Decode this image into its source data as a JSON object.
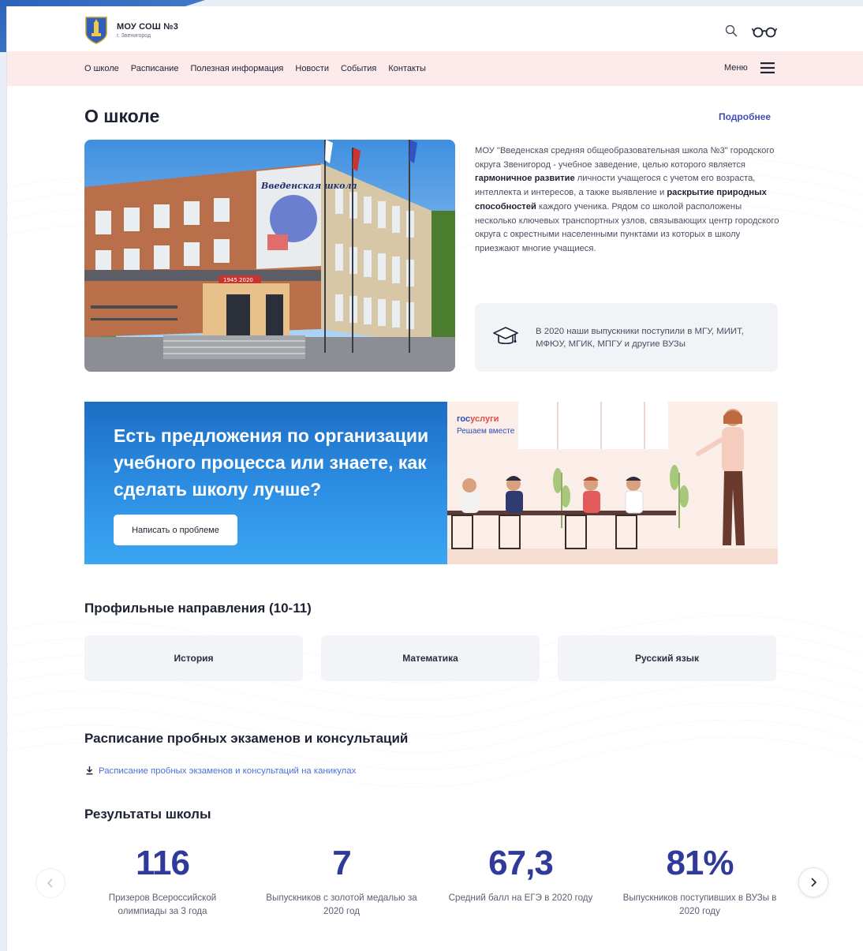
{
  "header": {
    "logo_title": "МОУ СОШ №3",
    "logo_subtitle": "г. Звенигород"
  },
  "nav": {
    "items": [
      "О школе",
      "Расписание",
      "Полезная информация",
      "Новости",
      "События",
      "Контакты"
    ],
    "menu_label": "Меню"
  },
  "about": {
    "title": "О школе",
    "more_link": "Подробнее",
    "text_1": "МОУ \"Введенская средняя общеобразовательная школа №3\" городского округа Звенигород - учебное заведение, целью которого является ",
    "text_bold_1": "гармоничное развитие",
    "text_2": " личности учащегося с учетом его возраста, интеллекта и интересов, а также выявление и ",
    "text_bold_2": "раскрытие природных способностей",
    "text_3": " каждого ученика. Рядом со школой расположены несколько ключевых транспортных узлов, связывающих центр городского округа с окрестными населенными пунктами из которых в школу приезжают многие учащиеся.",
    "photo_sign": "Введенская школа",
    "photo_banner": "1945 2020",
    "grads_text": "В 2020 наши выпускники поступили в МГУ, МИИТ, МФЮУ, МГИК, МПГУ и другие ВУЗы"
  },
  "banner": {
    "title": "Есть предложения по организации учебного процесса или знаете, как сделать школу лучше?",
    "button": "Написать о проблеме",
    "gos_logo_a": "гос",
    "gos_logo_b": "услуги",
    "gos_sub": "Решаем вместе"
  },
  "profile": {
    "title": "Профильные направления (10-11)",
    "items": [
      "История",
      "Математика",
      "Русский язык"
    ]
  },
  "schedule": {
    "title": "Расписание пробных экзаменов и консультаций",
    "link": "Расписание пробных экзаменов и консультаций на каникулах"
  },
  "results": {
    "title": "Результаты школы",
    "stats": [
      {
        "value": "116",
        "label": "Призеров Всероссийской олимпиады за 3 года"
      },
      {
        "value": "7",
        "label": "Выпускников с золотой медалью за 2020 год"
      },
      {
        "value": "67,3",
        "label": "Средний балл на ЕГЭ в 2020 году"
      },
      {
        "value": "81%",
        "label": "Выпускников поступивших в ВУЗы в 2020 году"
      }
    ]
  },
  "colors": {
    "accent": "#3f4fb6",
    "stat_value": "#2f3a9a",
    "nav_bg": "#fcebea",
    "banner_blue": "#2d8fe4",
    "link": "#4c6fd6"
  }
}
